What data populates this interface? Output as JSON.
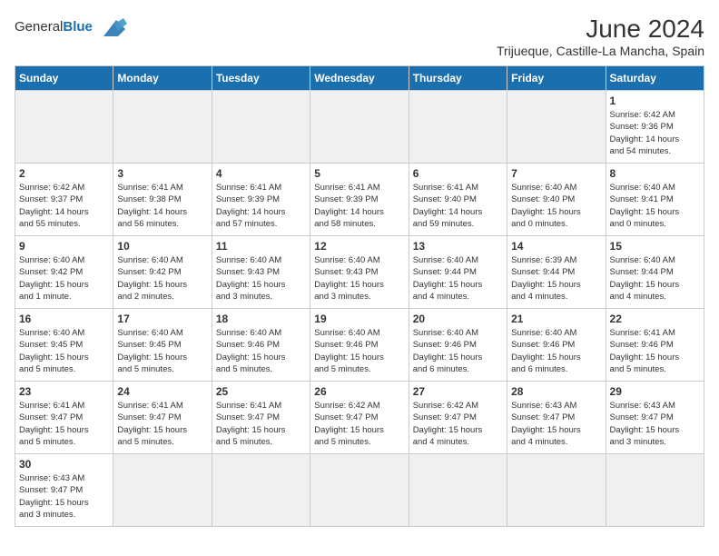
{
  "header": {
    "logo_general": "General",
    "logo_blue": "Blue",
    "title": "June 2024",
    "location": "Trijueque, Castille-La Mancha, Spain"
  },
  "weekdays": [
    "Sunday",
    "Monday",
    "Tuesday",
    "Wednesday",
    "Thursday",
    "Friday",
    "Saturday"
  ],
  "weeks": [
    [
      {
        "day": "",
        "info": "",
        "empty": true
      },
      {
        "day": "",
        "info": "",
        "empty": true
      },
      {
        "day": "",
        "info": "",
        "empty": true
      },
      {
        "day": "",
        "info": "",
        "empty": true
      },
      {
        "day": "",
        "info": "",
        "empty": true
      },
      {
        "day": "",
        "info": "",
        "empty": true
      },
      {
        "day": "1",
        "info": "Sunrise: 6:42 AM\nSunset: 9:36 PM\nDaylight: 14 hours\nand 54 minutes."
      }
    ],
    [
      {
        "day": "2",
        "info": "Sunrise: 6:42 AM\nSunset: 9:37 PM\nDaylight: 14 hours\nand 55 minutes."
      },
      {
        "day": "3",
        "info": "Sunrise: 6:41 AM\nSunset: 9:38 PM\nDaylight: 14 hours\nand 56 minutes."
      },
      {
        "day": "4",
        "info": "Sunrise: 6:41 AM\nSunset: 9:39 PM\nDaylight: 14 hours\nand 57 minutes."
      },
      {
        "day": "5",
        "info": "Sunrise: 6:41 AM\nSunset: 9:39 PM\nDaylight: 14 hours\nand 58 minutes."
      },
      {
        "day": "6",
        "info": "Sunrise: 6:41 AM\nSunset: 9:40 PM\nDaylight: 14 hours\nand 59 minutes."
      },
      {
        "day": "7",
        "info": "Sunrise: 6:40 AM\nSunset: 9:40 PM\nDaylight: 15 hours\nand 0 minutes."
      },
      {
        "day": "8",
        "info": "Sunrise: 6:40 AM\nSunset: 9:41 PM\nDaylight: 15 hours\nand 0 minutes."
      }
    ],
    [
      {
        "day": "9",
        "info": "Sunrise: 6:40 AM\nSunset: 9:42 PM\nDaylight: 15 hours\nand 1 minute."
      },
      {
        "day": "10",
        "info": "Sunrise: 6:40 AM\nSunset: 9:42 PM\nDaylight: 15 hours\nand 2 minutes."
      },
      {
        "day": "11",
        "info": "Sunrise: 6:40 AM\nSunset: 9:43 PM\nDaylight: 15 hours\nand 3 minutes."
      },
      {
        "day": "12",
        "info": "Sunrise: 6:40 AM\nSunset: 9:43 PM\nDaylight: 15 hours\nand 3 minutes."
      },
      {
        "day": "13",
        "info": "Sunrise: 6:40 AM\nSunset: 9:44 PM\nDaylight: 15 hours\nand 4 minutes."
      },
      {
        "day": "14",
        "info": "Sunrise: 6:39 AM\nSunset: 9:44 PM\nDaylight: 15 hours\nand 4 minutes."
      },
      {
        "day": "15",
        "info": "Sunrise: 6:40 AM\nSunset: 9:44 PM\nDaylight: 15 hours\nand 4 minutes."
      }
    ],
    [
      {
        "day": "16",
        "info": "Sunrise: 6:40 AM\nSunset: 9:45 PM\nDaylight: 15 hours\nand 5 minutes."
      },
      {
        "day": "17",
        "info": "Sunrise: 6:40 AM\nSunset: 9:45 PM\nDaylight: 15 hours\nand 5 minutes."
      },
      {
        "day": "18",
        "info": "Sunrise: 6:40 AM\nSunset: 9:46 PM\nDaylight: 15 hours\nand 5 minutes."
      },
      {
        "day": "19",
        "info": "Sunrise: 6:40 AM\nSunset: 9:46 PM\nDaylight: 15 hours\nand 5 minutes."
      },
      {
        "day": "20",
        "info": "Sunrise: 6:40 AM\nSunset: 9:46 PM\nDaylight: 15 hours\nand 6 minutes."
      },
      {
        "day": "21",
        "info": "Sunrise: 6:40 AM\nSunset: 9:46 PM\nDaylight: 15 hours\nand 6 minutes."
      },
      {
        "day": "22",
        "info": "Sunrise: 6:41 AM\nSunset: 9:46 PM\nDaylight: 15 hours\nand 5 minutes."
      }
    ],
    [
      {
        "day": "23",
        "info": "Sunrise: 6:41 AM\nSunset: 9:47 PM\nDaylight: 15 hours\nand 5 minutes."
      },
      {
        "day": "24",
        "info": "Sunrise: 6:41 AM\nSunset: 9:47 PM\nDaylight: 15 hours\nand 5 minutes."
      },
      {
        "day": "25",
        "info": "Sunrise: 6:41 AM\nSunset: 9:47 PM\nDaylight: 15 hours\nand 5 minutes."
      },
      {
        "day": "26",
        "info": "Sunrise: 6:42 AM\nSunset: 9:47 PM\nDaylight: 15 hours\nand 5 minutes."
      },
      {
        "day": "27",
        "info": "Sunrise: 6:42 AM\nSunset: 9:47 PM\nDaylight: 15 hours\nand 4 minutes."
      },
      {
        "day": "28",
        "info": "Sunrise: 6:43 AM\nSunset: 9:47 PM\nDaylight: 15 hours\nand 4 minutes."
      },
      {
        "day": "29",
        "info": "Sunrise: 6:43 AM\nSunset: 9:47 PM\nDaylight: 15 hours\nand 3 minutes."
      }
    ],
    [
      {
        "day": "30",
        "info": "Sunrise: 6:43 AM\nSunset: 9:47 PM\nDaylight: 15 hours\nand 3 minutes.",
        "lastrow": true
      },
      {
        "day": "",
        "info": "",
        "empty": true,
        "lastrow": true
      },
      {
        "day": "",
        "info": "",
        "empty": true,
        "lastrow": true
      },
      {
        "day": "",
        "info": "",
        "empty": true,
        "lastrow": true
      },
      {
        "day": "",
        "info": "",
        "empty": true,
        "lastrow": true
      },
      {
        "day": "",
        "info": "",
        "empty": true,
        "lastrow": true
      },
      {
        "day": "",
        "info": "",
        "empty": true,
        "lastrow": true
      }
    ]
  ]
}
